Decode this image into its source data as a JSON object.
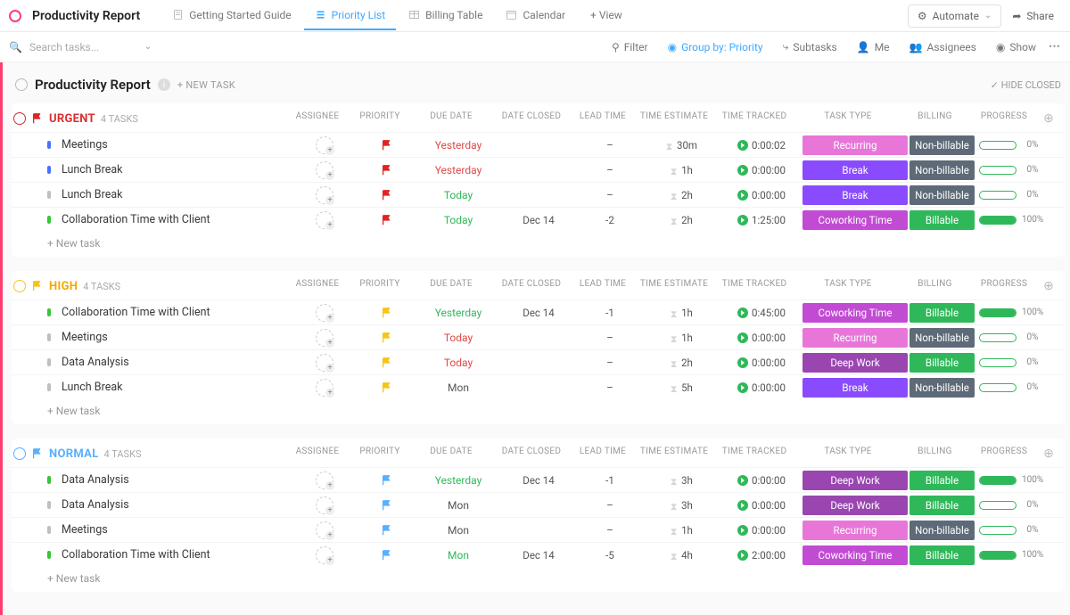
{
  "header": {
    "title": "Productivity Report",
    "tabs": [
      {
        "label": "Getting Started Guide",
        "icon": "doc"
      },
      {
        "label": "Priority List",
        "icon": "list",
        "active": true
      },
      {
        "label": "Billing Table",
        "icon": "table"
      },
      {
        "label": "Calendar",
        "icon": "calendar"
      }
    ],
    "addView": "+ View",
    "automate": "Automate",
    "share": "Share"
  },
  "toolbar": {
    "searchPlaceholder": "Search tasks...",
    "filter": "Filter",
    "groupBy": "Group by: Priority",
    "subtasks": "Subtasks",
    "me": "Me",
    "assignees": "Assignees",
    "show": "Show"
  },
  "list": {
    "title": "Productivity Report",
    "newTask": "+ NEW TASK",
    "hideClosed": "HIDE CLOSED"
  },
  "columns": [
    "ASSIGNEE",
    "PRIORITY",
    "DUE DATE",
    "DATE CLOSED",
    "LEAD TIME",
    "TIME ESTIMATE",
    "TIME TRACKED",
    "TASK TYPE",
    "BILLING",
    "PROGRESS"
  ],
  "groups": [
    {
      "name": "URGENT",
      "count": "4 TASKS",
      "flag": "#e02424",
      "nameClass": "u",
      "tasks": [
        {
          "sq": "blue",
          "name": "Meetings",
          "pri": "#e02424",
          "due": "Yesterday",
          "dueC": "red",
          "closed": "",
          "lead": "–",
          "est": "30m",
          "track": "0:00:02",
          "type": "Recurring",
          "typeC": "rec",
          "bill": "Non-billable",
          "billC": "nb",
          "prog": 0
        },
        {
          "sq": "blue",
          "name": "Lunch Break",
          "pri": "#e02424",
          "due": "Yesterday",
          "dueC": "red",
          "closed": "",
          "lead": "–",
          "est": "1h",
          "track": "0:00:00",
          "type": "Break",
          "typeC": "brk",
          "bill": "Non-billable",
          "billC": "nb",
          "prog": 0
        },
        {
          "sq": "grey",
          "name": "Lunch Break",
          "pri": "#e02424",
          "due": "Today",
          "dueC": "grn",
          "closed": "",
          "lead": "–",
          "est": "2h",
          "track": "0:00:00",
          "type": "Break",
          "typeC": "brk",
          "bill": "Non-billable",
          "billC": "nb",
          "prog": 0
        },
        {
          "sq": "green",
          "name": "Collaboration Time with Client",
          "pri": "#e02424",
          "due": "Today",
          "dueC": "grn",
          "closed": "Dec 14",
          "lead": "-2",
          "est": "2h",
          "track": "1:25:00",
          "type": "Coworking Time",
          "typeC": "cw",
          "bill": "Billable",
          "billC": "bl",
          "prog": 100
        }
      ]
    },
    {
      "name": "HIGH",
      "count": "4 TASKS",
      "flag": "#f5c518",
      "nameClass": "h",
      "tasks": [
        {
          "sq": "green",
          "name": "Collaboration Time with Client",
          "pri": "#f5c518",
          "due": "Yesterday",
          "dueC": "grn",
          "closed": "Dec 14",
          "lead": "-1",
          "est": "1h",
          "track": "0:45:00",
          "type": "Coworking Time",
          "typeC": "cw",
          "bill": "Billable",
          "billC": "bl",
          "prog": 100
        },
        {
          "sq": "grey",
          "name": "Meetings",
          "pri": "#f5c518",
          "due": "Today",
          "dueC": "red",
          "closed": "",
          "lead": "–",
          "est": "1h",
          "track": "0:00:00",
          "type": "Recurring",
          "typeC": "rec",
          "bill": "Non-billable",
          "billC": "nb",
          "prog": 0
        },
        {
          "sq": "grey",
          "name": "Data Analysis",
          "pri": "#f5c518",
          "due": "Today",
          "dueC": "red",
          "closed": "",
          "lead": "–",
          "est": "2h",
          "track": "0:00:00",
          "type": "Deep Work",
          "typeC": "dw",
          "bill": "Billable",
          "billC": "bl",
          "prog": 0
        },
        {
          "sq": "grey",
          "name": "Lunch Break",
          "pri": "#f5c518",
          "due": "Mon",
          "dueC": "",
          "closed": "",
          "lead": "–",
          "est": "5h",
          "track": "0:00:00",
          "type": "Break",
          "typeC": "brk",
          "bill": "Non-billable",
          "billC": "nb",
          "prog": 0
        }
      ]
    },
    {
      "name": "NORMAL",
      "count": "4 TASKS",
      "flag": "#5ab0ff",
      "nameClass": "n",
      "tasks": [
        {
          "sq": "green",
          "name": "Data Analysis",
          "pri": "#5ab0ff",
          "due": "Yesterday",
          "dueC": "grn",
          "closed": "Dec 14",
          "lead": "-1",
          "est": "3h",
          "track": "0:00:00",
          "type": "Deep Work",
          "typeC": "dw",
          "bill": "Billable",
          "billC": "bl",
          "prog": 100
        },
        {
          "sq": "grey",
          "name": "Data Analysis",
          "pri": "#5ab0ff",
          "due": "Mon",
          "dueC": "",
          "closed": "",
          "lead": "–",
          "est": "3h",
          "track": "0:00:00",
          "type": "Deep Work",
          "typeC": "dw",
          "bill": "Billable",
          "billC": "bl",
          "prog": 0
        },
        {
          "sq": "grey",
          "name": "Meetings",
          "pri": "#5ab0ff",
          "due": "Mon",
          "dueC": "",
          "closed": "",
          "lead": "–",
          "est": "1h",
          "track": "0:00:00",
          "type": "Recurring",
          "typeC": "rec",
          "bill": "Non-billable",
          "billC": "nb",
          "prog": 0
        },
        {
          "sq": "green",
          "name": "Collaboration Time with Client",
          "pri": "#5ab0ff",
          "due": "Mon",
          "dueC": "grn",
          "closed": "Dec 14",
          "lead": "-5",
          "est": "4h",
          "track": "2:00:00",
          "type": "Coworking Time",
          "typeC": "cw",
          "bill": "Billable",
          "billC": "bl",
          "prog": 100
        }
      ]
    }
  ],
  "newTaskRow": "+ New task",
  "checkmark": "✓"
}
